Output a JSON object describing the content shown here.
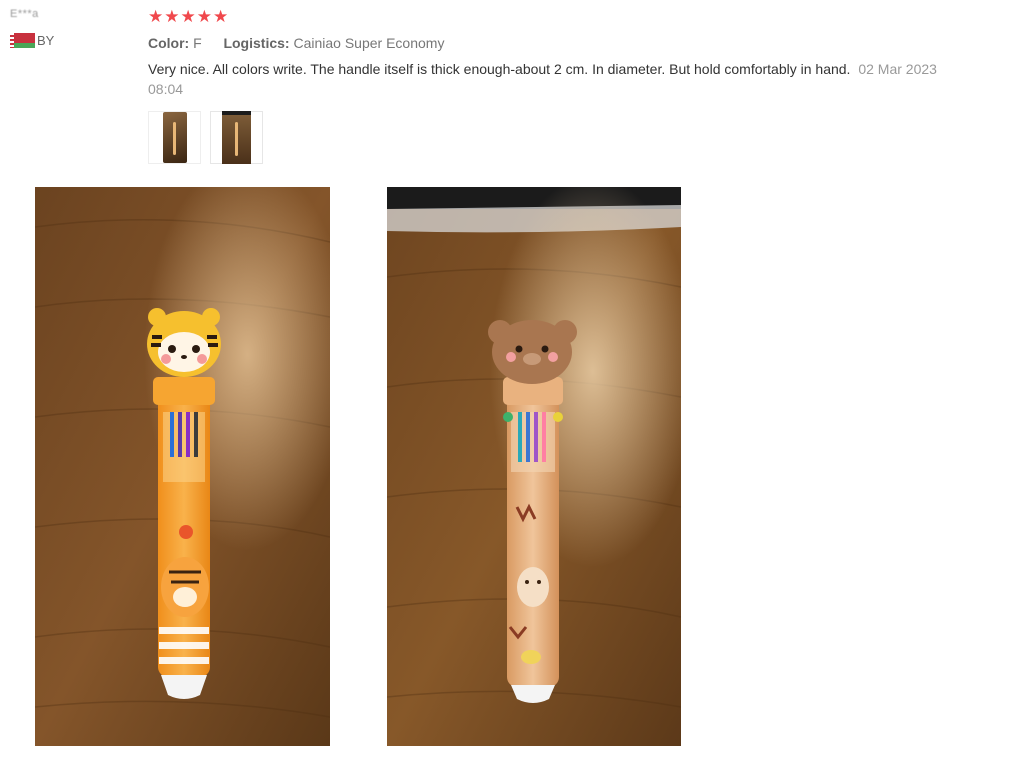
{
  "reviewer": {
    "username": "E***a",
    "country_code": "BY"
  },
  "review": {
    "rating": 5,
    "stars": [
      "★",
      "★",
      "★",
      "★",
      "★"
    ],
    "color_label": "Color:",
    "color_value": "F",
    "logistics_label": "Logistics:",
    "logistics_value": "Cainiao Super Economy",
    "text": "Very nice. All colors write. The handle itself is thick enough-about 2 cm. In diameter. But hold comfortably in hand.",
    "date": "02 Mar 2023 08:04"
  },
  "thumbnails": [
    {
      "name": "thumbnail-1",
      "icon": "photo-icon"
    },
    {
      "name": "thumbnail-2",
      "icon": "photo-icon"
    }
  ],
  "photos": [
    {
      "subject": "tiger-pen-photo"
    },
    {
      "subject": "bear-pen-photo"
    }
  ],
  "colors": {
    "star": "#f0484c",
    "wood": "#7a4d22",
    "tiger_pen": "#f6a531",
    "bear_pen": "#e8b98c"
  }
}
